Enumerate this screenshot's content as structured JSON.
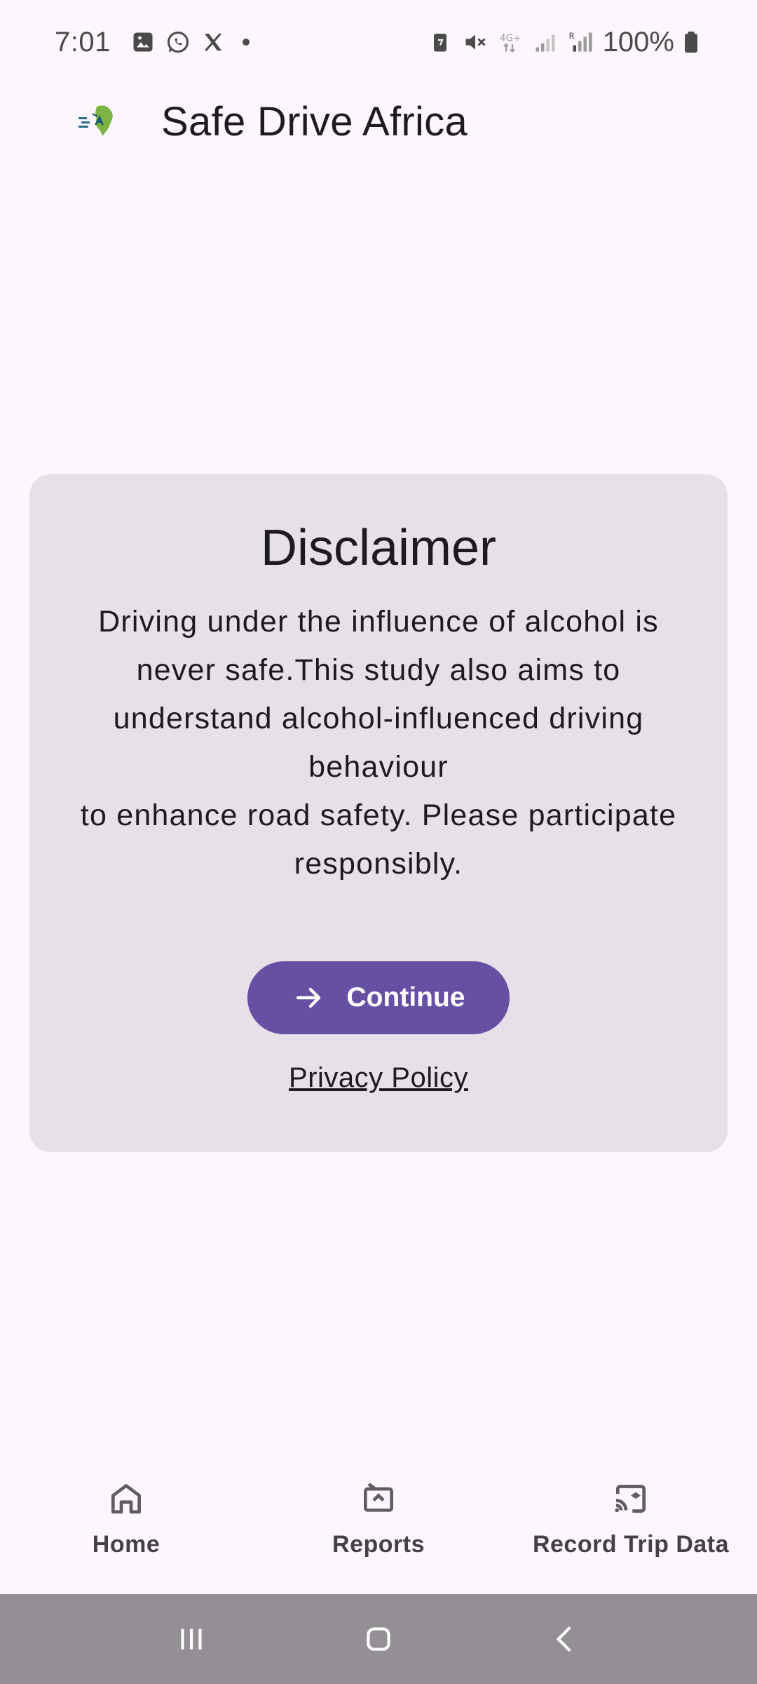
{
  "status_bar": {
    "time": "7:01",
    "battery": "100%",
    "left_icons": [
      "gallery-icon",
      "whatsapp-icon",
      "x-icon"
    ],
    "right_icons": [
      "battery-saver-icon",
      "mute-icon",
      "4g-icon",
      "signal-icon",
      "roaming-signal-icon",
      "battery-icon"
    ]
  },
  "app_bar": {
    "title": "Safe Drive Africa",
    "logo_icon": "safe-drive-africa-logo"
  },
  "disclaimer": {
    "title": "Disclaimer",
    "body": "Driving under the influence of alcohol is never safe.This study also aims to understand alcohol-influenced driving behaviour\nto enhance road safety. Please participate responsibly.",
    "continue_label": "Continue",
    "continue_icon": "arrow-right-icon",
    "privacy_label": "Privacy Policy"
  },
  "bottom_nav": {
    "items": [
      {
        "label": "Home",
        "icon": "home-icon"
      },
      {
        "label": "Reports",
        "icon": "reports-icon"
      },
      {
        "label": "Record Trip Data",
        "icon": "cast-icon"
      }
    ]
  },
  "colors": {
    "background": "#fdf7fd",
    "card": "#e6e0e8",
    "primary": "#6750a4",
    "system_nav": "#938f94"
  }
}
